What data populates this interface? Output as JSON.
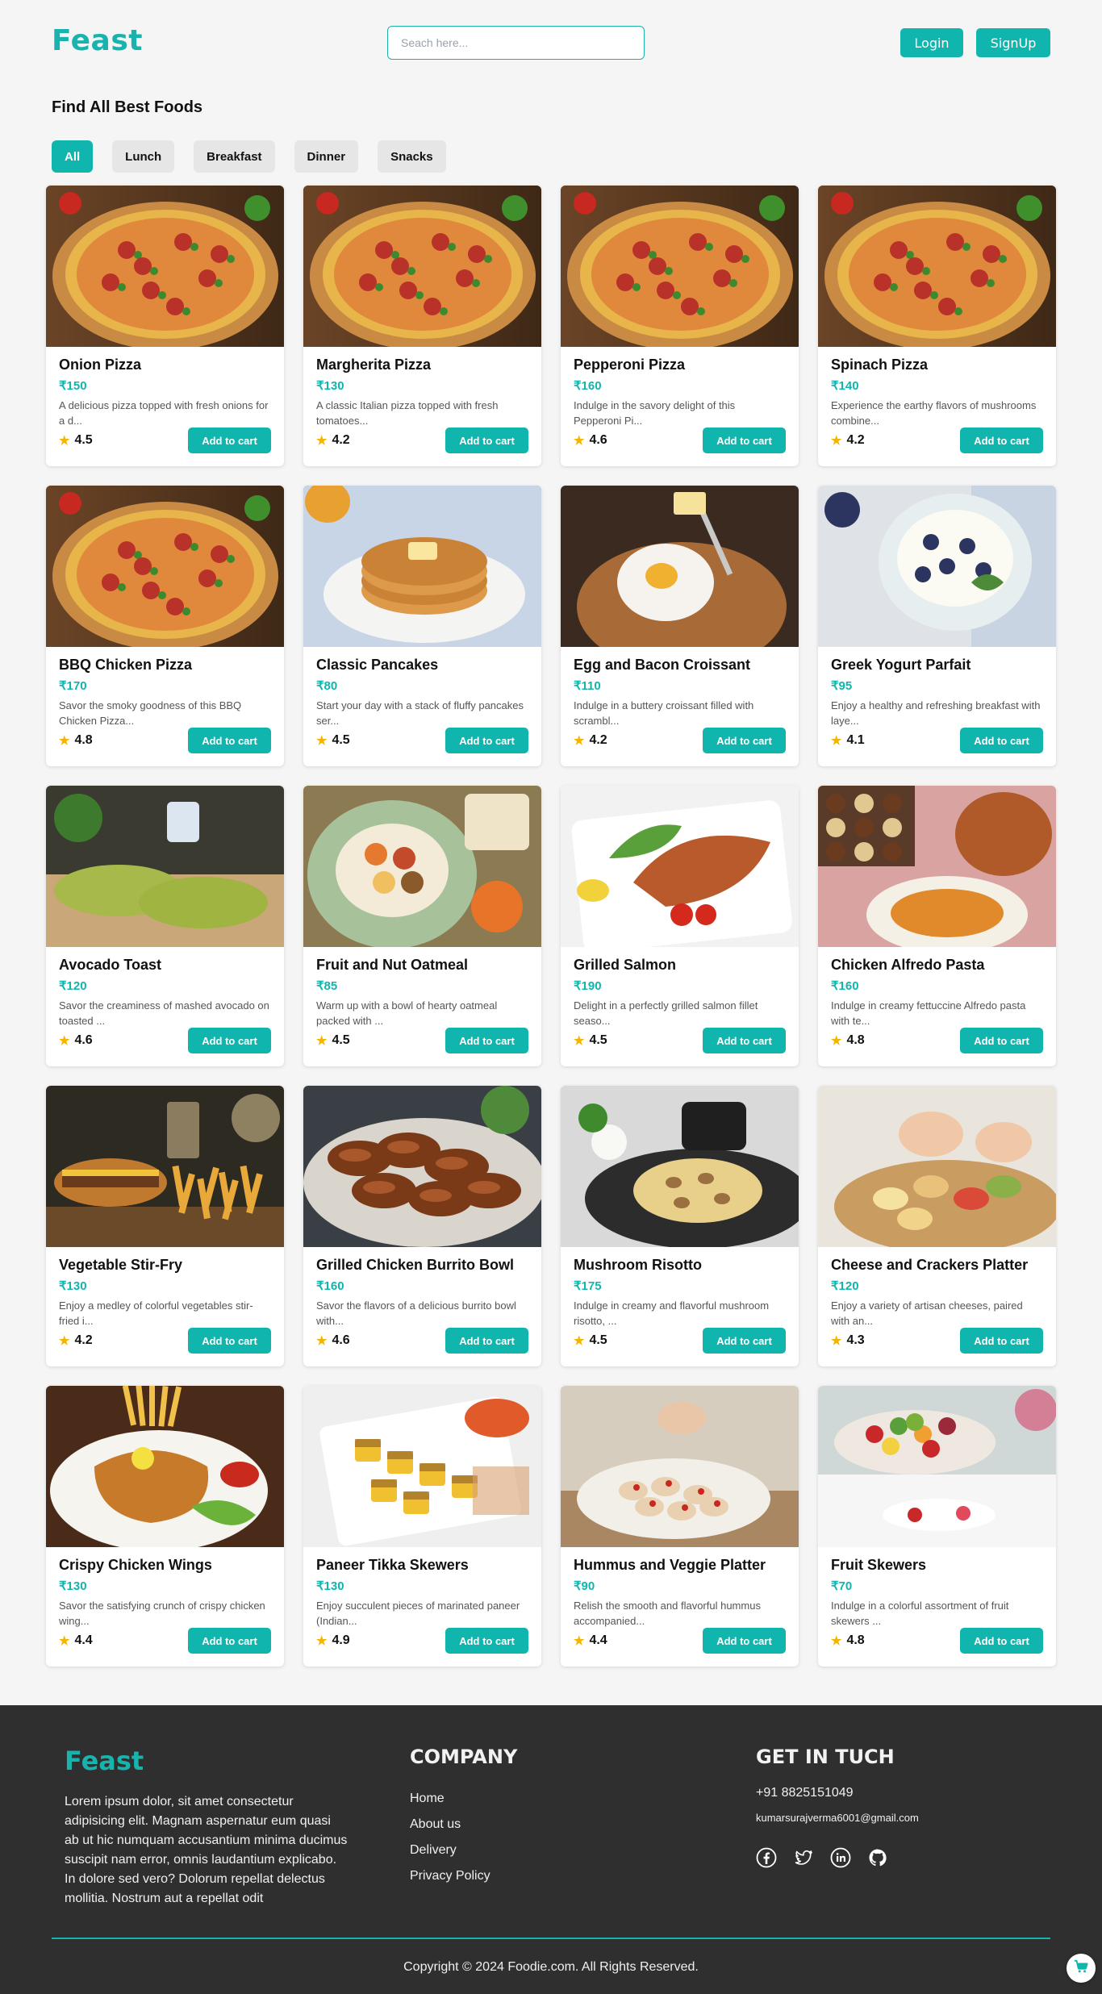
{
  "header": {
    "logo": "Feast",
    "search_placeholder": "Seach here...",
    "login_label": "Login",
    "signup_label": "SignUp"
  },
  "main": {
    "title": "Find All Best Foods",
    "filters": [
      "All",
      "Lunch",
      "Breakfast",
      "Dinner",
      "Snacks"
    ],
    "active_filter": "All",
    "add_label": "Add to cart",
    "items": [
      {
        "name": "Onion Pizza",
        "price": "₹150",
        "desc": "A delicious pizza topped with fresh onions for a d...",
        "rating": "4.5",
        "img": "pizza"
      },
      {
        "name": "Margherita Pizza",
        "price": "₹130",
        "desc": "A classic Italian pizza topped with fresh tomatoes...",
        "rating": "4.2",
        "img": "pizza"
      },
      {
        "name": "Pepperoni Pizza",
        "price": "₹160",
        "desc": "Indulge in the savory delight of this Pepperoni Pi...",
        "rating": "4.6",
        "img": "pizza"
      },
      {
        "name": "Spinach Pizza",
        "price": "₹140",
        "desc": "Experience the earthy flavors of mushrooms combine...",
        "rating": "4.2",
        "img": "pizza"
      },
      {
        "name": "BBQ Chicken Pizza",
        "price": "₹170",
        "desc": "Savor the smoky goodness of this BBQ Chicken Pizza...",
        "rating": "4.8",
        "img": "pizza"
      },
      {
        "name": "Classic Pancakes",
        "price": "₹80",
        "desc": "Start your day with a stack of fluffy pancakes ser...",
        "rating": "4.5",
        "img": "pancake"
      },
      {
        "name": "Egg and Bacon Croissant",
        "price": "₹110",
        "desc": "Indulge in a buttery croissant filled with scrambl...",
        "rating": "4.2",
        "img": "egg"
      },
      {
        "name": "Greek Yogurt Parfait",
        "price": "₹95",
        "desc": "Enjoy a healthy and refreshing breakfast with laye...",
        "rating": "4.1",
        "img": "yogurt"
      },
      {
        "name": "Avocado Toast",
        "price": "₹120",
        "desc": "Savor the creaminess of mashed avocado on toasted ...",
        "rating": "4.6",
        "img": "toast"
      },
      {
        "name": "Fruit and Nut Oatmeal",
        "price": "₹85",
        "desc": "Warm up with a bowl of hearty oatmeal packed with ...",
        "rating": "4.5",
        "img": "bowl"
      },
      {
        "name": "Grilled Salmon",
        "price": "₹190",
        "desc": "Delight in a perfectly grilled salmon fillet seaso...",
        "rating": "4.5",
        "img": "salmon"
      },
      {
        "name": "Chicken Alfredo Pasta",
        "price": "₹160",
        "desc": "Indulge in creamy fettuccine Alfredo pasta with te...",
        "rating": "4.8",
        "img": "pasta"
      },
      {
        "name": "Vegetable Stir-Fry",
        "price": "₹130",
        "desc": "Enjoy a medley of colorful vegetables stir-fried i...",
        "rating": "4.2",
        "img": "burger"
      },
      {
        "name": "Grilled Chicken Burrito Bowl",
        "price": "₹160",
        "desc": "Savor the flavors of a delicious burrito bowl with...",
        "rating": "4.6",
        "img": "grill"
      },
      {
        "name": "Mushroom Risotto",
        "price": "₹175",
        "desc": "Indulge in creamy and flavorful mushroom risotto, ...",
        "rating": "4.5",
        "img": "risotto"
      },
      {
        "name": "Cheese and Crackers Platter",
        "price": "₹120",
        "desc": "Enjoy a variety of artisan cheeses, paired with an...",
        "rating": "4.3",
        "img": "platter"
      },
      {
        "name": "Crispy Chicken Wings",
        "price": "₹130",
        "desc": "Savor the satisfying crunch of crispy chicken wing...",
        "rating": "4.4",
        "img": "cutlet"
      },
      {
        "name": "Paneer Tikka Skewers",
        "price": "₹130",
        "desc": "Enjoy succulent pieces of marinated paneer (Indian...",
        "rating": "4.9",
        "img": "skewer"
      },
      {
        "name": "Hummus and Veggie Platter",
        "price": "₹90",
        "desc": "Relish the smooth and flavorful hummus accompanied...",
        "rating": "4.4",
        "img": "hummus"
      },
      {
        "name": "Fruit Skewers",
        "price": "₹70",
        "desc": "Indulge in a colorful assortment of fruit skewers ...",
        "rating": "4.8",
        "img": "fruit"
      }
    ]
  },
  "footer": {
    "logo": "Feast",
    "about": "Lorem ipsum dolor, sit amet consectetur adipisicing elit. Magnam aspernatur eum quasi ab ut hic numquam accusantium minima ducimus suscipit nam error, omnis laudantium explicabo. In dolore sed vero? Dolorum repellat delectus mollitia. Nostrum aut a repellat odit",
    "company_title": "COMPANY",
    "links": [
      "Home",
      "About us",
      "Delivery",
      "Privacy Policy"
    ],
    "contact_title": "GET IN TUCH",
    "phone": "+91 8825151049",
    "email": "kumarsurajverma6001@gmail.com",
    "social_icons": [
      "facebook-icon",
      "twitter-icon",
      "linkedin-icon",
      "github-icon"
    ],
    "copyright": "Copyright © 2024 Foodie.com. All Rights Reserved."
  },
  "colors": {
    "accent": "#10b5ad",
    "footer_bg": "#2f2f2f",
    "star": "#f5b400"
  }
}
